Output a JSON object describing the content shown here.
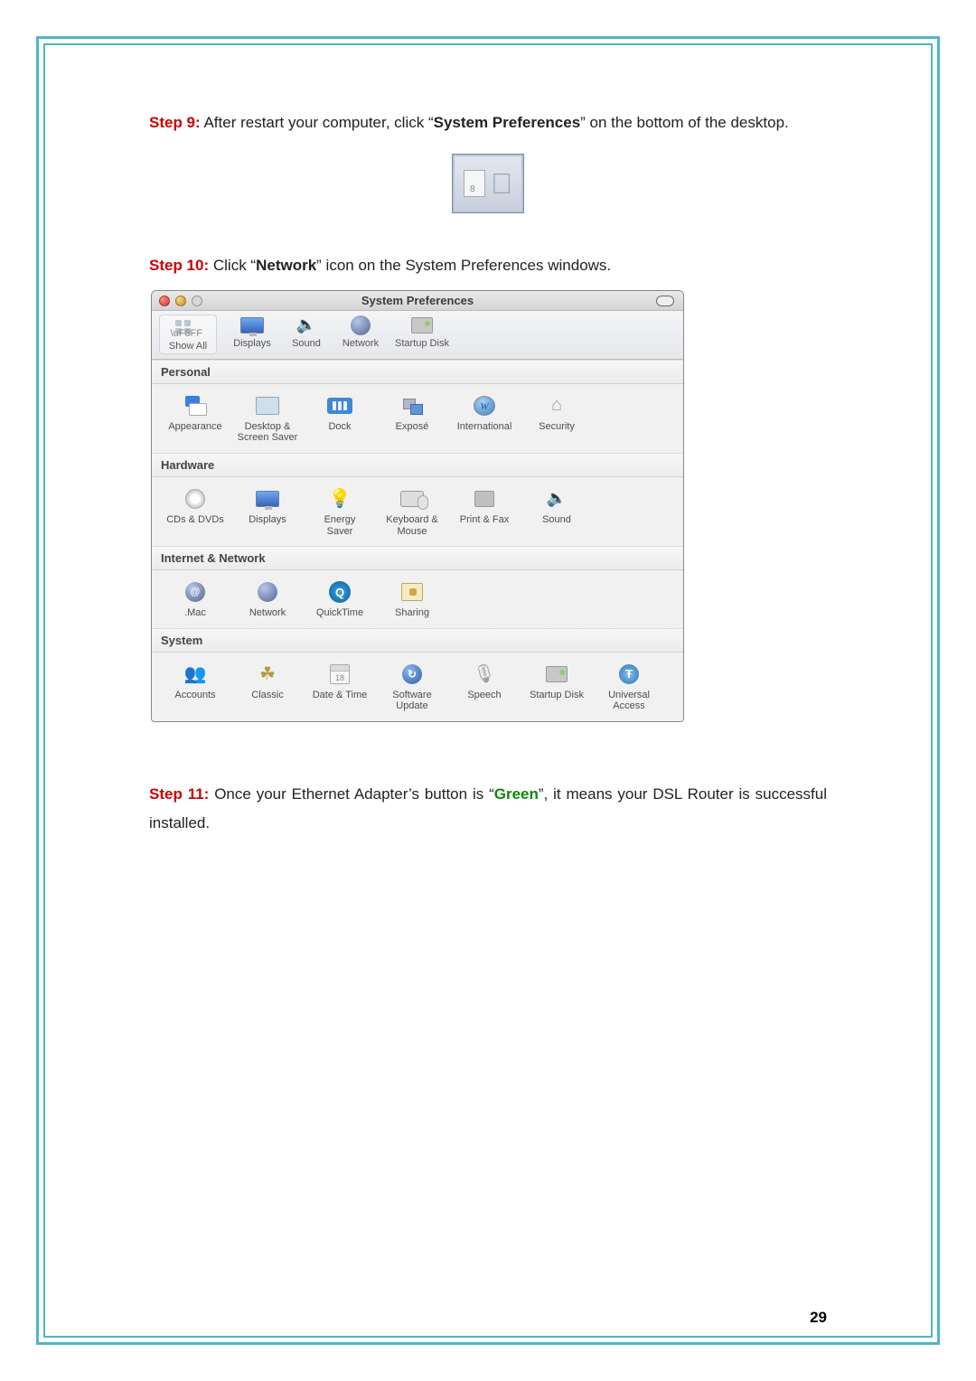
{
  "steps": {
    "s9": {
      "label": "Step 9:",
      "t1": " After restart your computer, click “",
      "bold1": "System Preferences",
      "t2": "” on the bottom of the desktop."
    },
    "s10": {
      "label": "Step 10:",
      "t1": " Click “",
      "bold1": "Network",
      "t2": "” icon on the System Preferences windows."
    },
    "s11": {
      "label": "Step 11:",
      "t1": " Once your Ethernet Adapter’s button is “",
      "green": "Green",
      "t2": "”, it means your DSL Router is successful installed."
    }
  },
  "dock": {
    "apple": ""
  },
  "sp": {
    "title": "System Preferences",
    "toolbar": {
      "show_all": "Show All",
      "displays": "Displays",
      "sound": "Sound",
      "network": "Network",
      "startup": "Startup Disk"
    },
    "sections": {
      "personal": {
        "heading": "Personal",
        "items": {
          "appearance": "Appearance",
          "desktop": "Desktop &\nScreen Saver",
          "dock": "Dock",
          "expose": "Exposé",
          "international": "International",
          "security": "Security"
        }
      },
      "hardware": {
        "heading": "Hardware",
        "items": {
          "cds": "CDs & DVDs",
          "displays": "Displays",
          "energy": "Energy\nSaver",
          "keyboard": "Keyboard &\nMouse",
          "printfax": "Print & Fax",
          "sound": "Sound"
        }
      },
      "internet": {
        "heading": "Internet & Network",
        "items": {
          "mac": ".Mac",
          "network": "Network",
          "quicktime": "QuickTime",
          "sharing": "Sharing"
        }
      },
      "system": {
        "heading": "System",
        "items": {
          "accounts": "Accounts",
          "classic": "Classic",
          "datetime": "Date & Time",
          "software": "Software\nUpdate",
          "speech": "Speech",
          "startup": "Startup Disk",
          "universal": "Universal\nAccess"
        }
      }
    }
  },
  "page_number": "29",
  "icons": {
    "intl_glyph": "W",
    "date_glyph": "18",
    "qt_glyph": "Q",
    "su_glyph": "↻",
    "ua_glyph": "Ŧ",
    "sound_glyph": "🔈",
    "security_glyph": "⌂",
    "energy_glyph": "💡",
    "accounts_glyph": "👥",
    "classic_glyph": "☘",
    "speech_glyph": "🎙"
  }
}
